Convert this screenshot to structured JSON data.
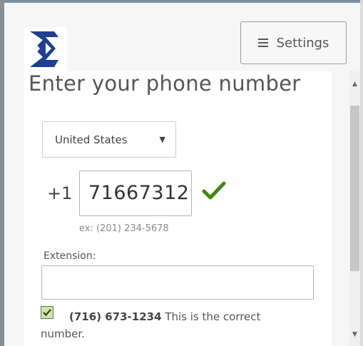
{
  "header": {
    "logo_icon": "company-logo-icon",
    "settings_label": "Settings",
    "settings_icon": "menu-icon"
  },
  "form": {
    "title": "Enter your phone number",
    "country": {
      "selected": "United States",
      "caret": "▼"
    },
    "country_code": "+1",
    "phone": {
      "value": "71667312",
      "example": "ex: (201) 234-5678",
      "valid_icon": "checkmark-icon",
      "valid_color": "#3b8a12"
    },
    "extension": {
      "label": "Extension:",
      "value": ""
    },
    "confirm": {
      "checked": true,
      "number": "(716) 673-1234",
      "text": "This is the correct number."
    }
  },
  "scrollbar": {
    "up_arrow": "▲",
    "down_arrow": "▼"
  },
  "colors": {
    "logo_blue": "#1f3e8f",
    "text": "#555555"
  }
}
